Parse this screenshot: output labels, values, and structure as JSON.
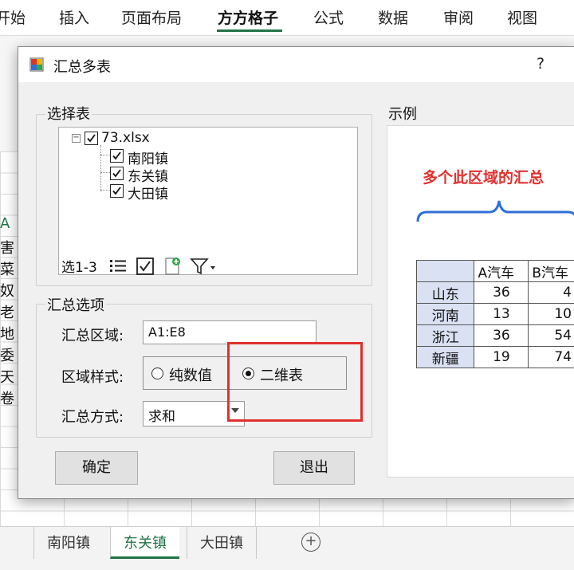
{
  "ribbon": {
    "tabs": [
      "开始",
      "插入",
      "页面布局",
      "方方格子",
      "公式",
      "数据",
      "审阅",
      "视图"
    ],
    "active_tab": "方方格子"
  },
  "sheet": {
    "left_column_partial": [
      "A",
      "害",
      "菜",
      "奴",
      "老",
      "地",
      "委",
      "天",
      "卷"
    ],
    "tabs": [
      "南阳镇",
      "东关镇",
      "大田镇"
    ],
    "active_tab": "东关镇",
    "add_sheet_glyph": "+"
  },
  "dialog": {
    "title": "汇总多表",
    "help_label": "?",
    "select_group": {
      "label": "选择表",
      "tree": {
        "root": "73.xlsx",
        "expander": "−",
        "children": [
          "南阳镇",
          "东关镇",
          "大田镇"
        ]
      },
      "selection_count": "选1-3"
    },
    "options_group": {
      "label": "汇总选项",
      "range_label": "汇总区域:",
      "range_value": "A1:E8",
      "style_label": "区域样式:",
      "style_options": [
        "纯数值",
        "二维表"
      ],
      "style_selected": "二维表",
      "method_label": "汇总方式:",
      "method_value": "求和"
    },
    "ok_label": "确定",
    "exit_label": "退出",
    "example": {
      "label": "示例",
      "caption": "多个此区域的汇总",
      "table": {
        "header": [
          "",
          "A汽车",
          "B汽车"
        ],
        "rows": [
          [
            "山东",
            "36",
            "4"
          ],
          [
            "河南",
            "13",
            "10"
          ],
          [
            "浙江",
            "36",
            "54"
          ],
          [
            "新疆",
            "19",
            "74"
          ]
        ]
      }
    }
  },
  "colors": {
    "accent_green": "#217346",
    "highlight_red": "#e0312f",
    "example_header_fill": "#d9e1f2"
  }
}
